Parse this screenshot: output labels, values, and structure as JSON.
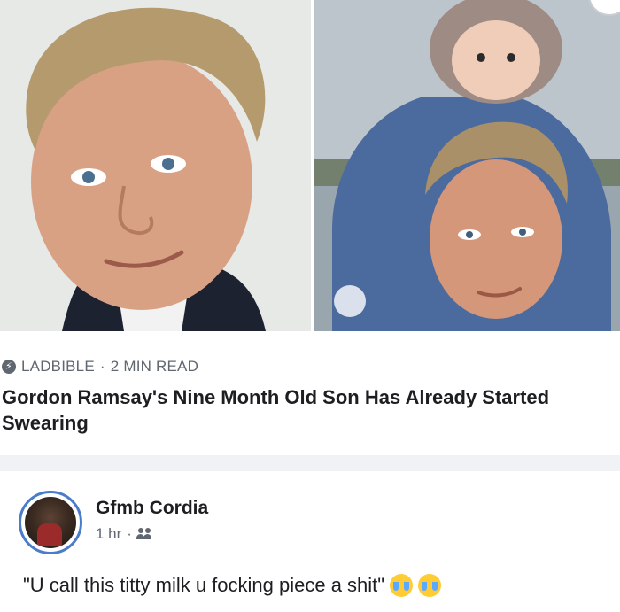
{
  "post": {
    "images": [
      {
        "alt": "Gordon Ramsay portrait"
      },
      {
        "alt": "Gordon Ramsay carrying his son on his shoulders"
      }
    ],
    "link_card": {
      "source": "LADBIBLE",
      "separator": "·",
      "read_time": "2 MIN READ",
      "headline": "Gordon Ramsay's Nine Month Old Son Has Already Started Swearing"
    }
  },
  "comment": {
    "author": "Gfmb Cordia",
    "time": "1 hr",
    "separator": "·",
    "audience_icon": "friends-icon",
    "text": "\"U call this titty milk u focking piece a shit\"",
    "emojis": [
      "loudly-crying-face-icon",
      "loudly-crying-face-icon"
    ]
  }
}
